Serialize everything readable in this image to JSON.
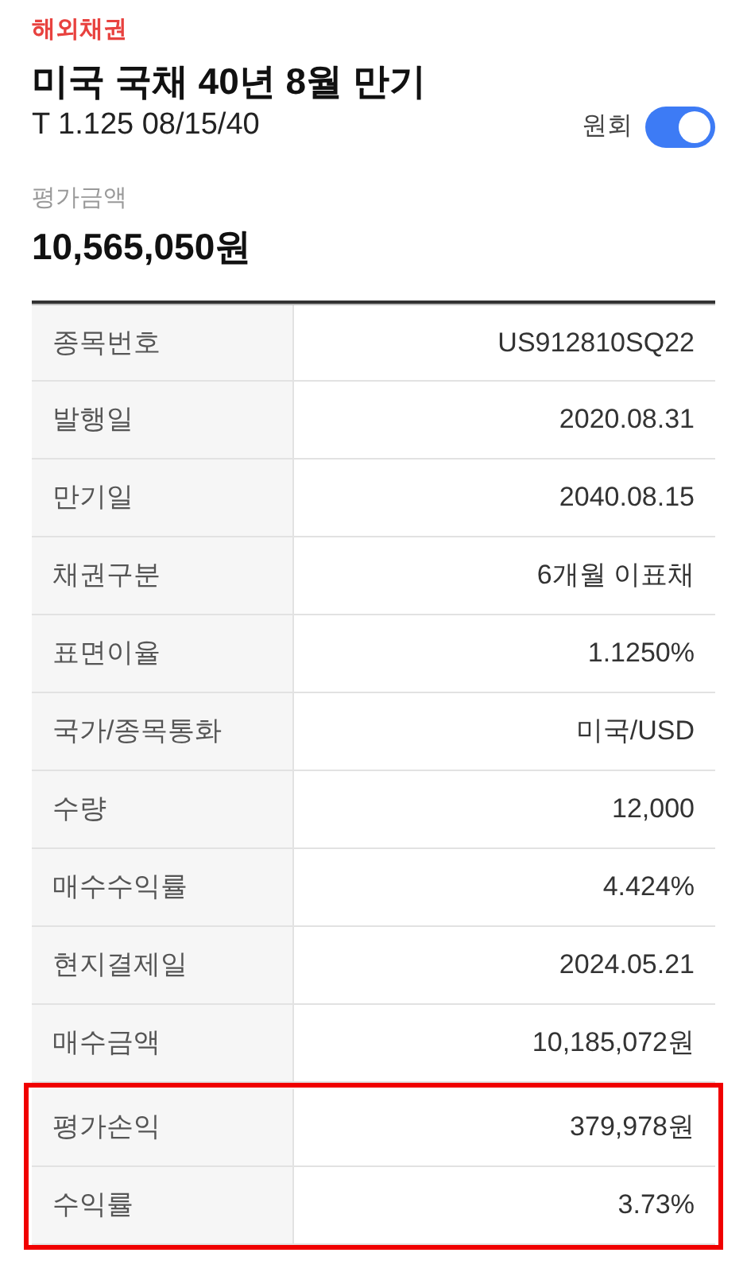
{
  "category": "해외채권",
  "title": "미국 국채 40년 8월 만기",
  "subtitle": "T 1.125 08/15/40",
  "currency_toggle": {
    "label": "원회",
    "on": true
  },
  "valuation": {
    "label": "평가금액",
    "value": "10,565,050원"
  },
  "rows": [
    {
      "label": "종목번호",
      "value": "US912810SQ22",
      "highlighted": false
    },
    {
      "label": "발행일",
      "value": "2020.08.31",
      "highlighted": false
    },
    {
      "label": "만기일",
      "value": "2040.08.15",
      "highlighted": false
    },
    {
      "label": "채권구분",
      "value": "6개월 이표채",
      "highlighted": false
    },
    {
      "label": "표면이율",
      "value": "1.1250%",
      "highlighted": false
    },
    {
      "label": "국가/종목통화",
      "value": "미국/USD",
      "highlighted": false
    },
    {
      "label": "수량",
      "value": "12,000",
      "highlighted": false
    },
    {
      "label": "매수수익률",
      "value": "4.424%",
      "highlighted": false
    },
    {
      "label": "현지결제일",
      "value": "2024.05.21",
      "highlighted": false
    },
    {
      "label": "매수금액",
      "value": "10,185,072원",
      "highlighted": false
    },
    {
      "label": "평가손익",
      "value": "379,978원",
      "highlighted": true
    },
    {
      "label": "수익률",
      "value": "3.73%",
      "highlighted": true
    }
  ]
}
